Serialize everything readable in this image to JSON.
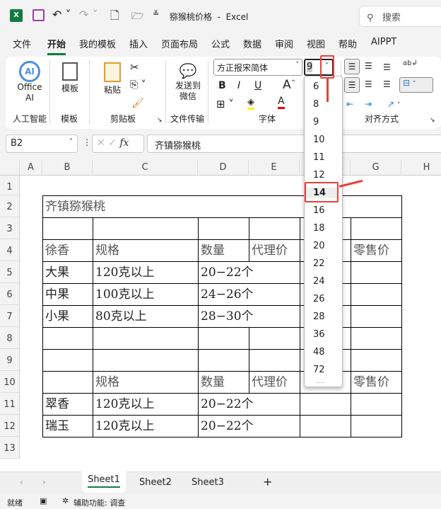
{
  "titlebar": {
    "doc_title": "猕猴桃价格  -  Excel",
    "search_placeholder": "搜索"
  },
  "menu": [
    "文件",
    "开始",
    "我的模板",
    "插入",
    "页面布局",
    "公式",
    "数据",
    "审阅",
    "视图",
    "帮助",
    "AIPPT"
  ],
  "ribbon": {
    "office_ai": "Office AI",
    "template": "模板",
    "paste": "粘贴",
    "send_wechat": "发送到微信",
    "font_name": "方正报宋简体",
    "font_size": "9",
    "bold": "B",
    "italic": "I",
    "underline": "U",
    "groups": [
      "人工智能",
      "模板",
      "剪贴板",
      "文件传输",
      "字体",
      "对齐方式"
    ]
  },
  "formula_bar": {
    "cell_ref": "B2",
    "fx": "fx",
    "content": "齐镇猕猴桃"
  },
  "columns": [
    "A",
    "B",
    "C",
    "D",
    "E",
    "F",
    "G",
    "H"
  ],
  "rows": [
    "1",
    "2",
    "3",
    "4",
    "5",
    "6",
    "7",
    "8",
    "9",
    "10",
    "11",
    "12",
    "13"
  ],
  "cells": {
    "title": "齐镇猕猴桃",
    "r4": [
      "徐香",
      "规格",
      "数量",
      "代理价",
      "零售价"
    ],
    "r5": [
      "大果",
      "120克以上",
      "20−22个"
    ],
    "r6": [
      "中果",
      "100克以上",
      "24−26个"
    ],
    "r7": [
      "小果",
      "80克以上",
      "28−30个"
    ],
    "r10": [
      "规格",
      "数量",
      "代理价",
      "零售价"
    ],
    "r11": [
      "翠香",
      "120克以上",
      "20−22个"
    ],
    "r12": [
      "瑞玉",
      "120克以上",
      "20−22个"
    ]
  },
  "font_size_options": [
    "6",
    "8",
    "9",
    "10",
    "11",
    "12",
    "14",
    "16",
    "18",
    "20",
    "22",
    "24",
    "26",
    "28",
    "36",
    "48",
    "72"
  ],
  "highlighted_size": "14",
  "sheets": [
    "Sheet1",
    "Sheet2",
    "Sheet3"
  ],
  "status": {
    "ready": "就绪",
    "accessibility": "辅助功能: 调查"
  },
  "colors": {
    "excel_green": "#107c41",
    "annotation_red": "#e8413c"
  }
}
